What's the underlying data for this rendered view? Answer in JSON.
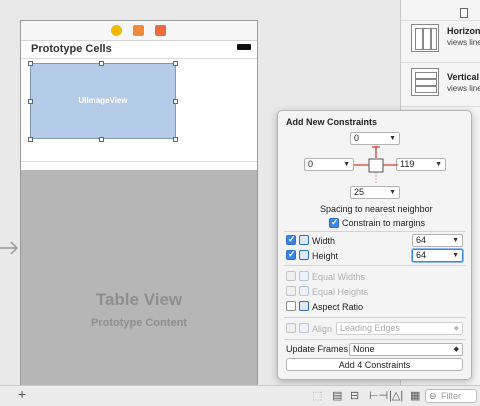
{
  "scene": {
    "prototype_cells_label": "Prototype Cells",
    "image_view_label": "UIImageView",
    "table_view_title": "Table View",
    "table_view_subtitle": "Prototype Content"
  },
  "library": {
    "items": [
      {
        "title": "Horizont",
        "desc": "views line"
      },
      {
        "title": "Vertical",
        "desc": "views line"
      }
    ]
  },
  "popover": {
    "title": "Add New Constraints",
    "top_value": "0",
    "left_value": "0",
    "right_value": "119",
    "bottom_value": "25",
    "spacing_caption": "Spacing to nearest neighbor",
    "constrain_margins_label": "Constrain to margins",
    "width_label": "Width",
    "width_value": "64",
    "height_label": "Height",
    "height_value": "64",
    "equal_widths_label": "Equal Widths",
    "equal_heights_label": "Equal Heights",
    "aspect_ratio_label": "Aspect Ratio",
    "align_label": "Align",
    "align_value": "Leading Edges",
    "update_frames_label": "Update Frames",
    "update_frames_value": "None",
    "add_button_label": "Add 4 Constraints",
    "accent_color": "#3a86e8",
    "strut_color": "#d9443a"
  },
  "bottombar": {
    "add_symbol": "+",
    "filter_placeholder": "Filter"
  }
}
